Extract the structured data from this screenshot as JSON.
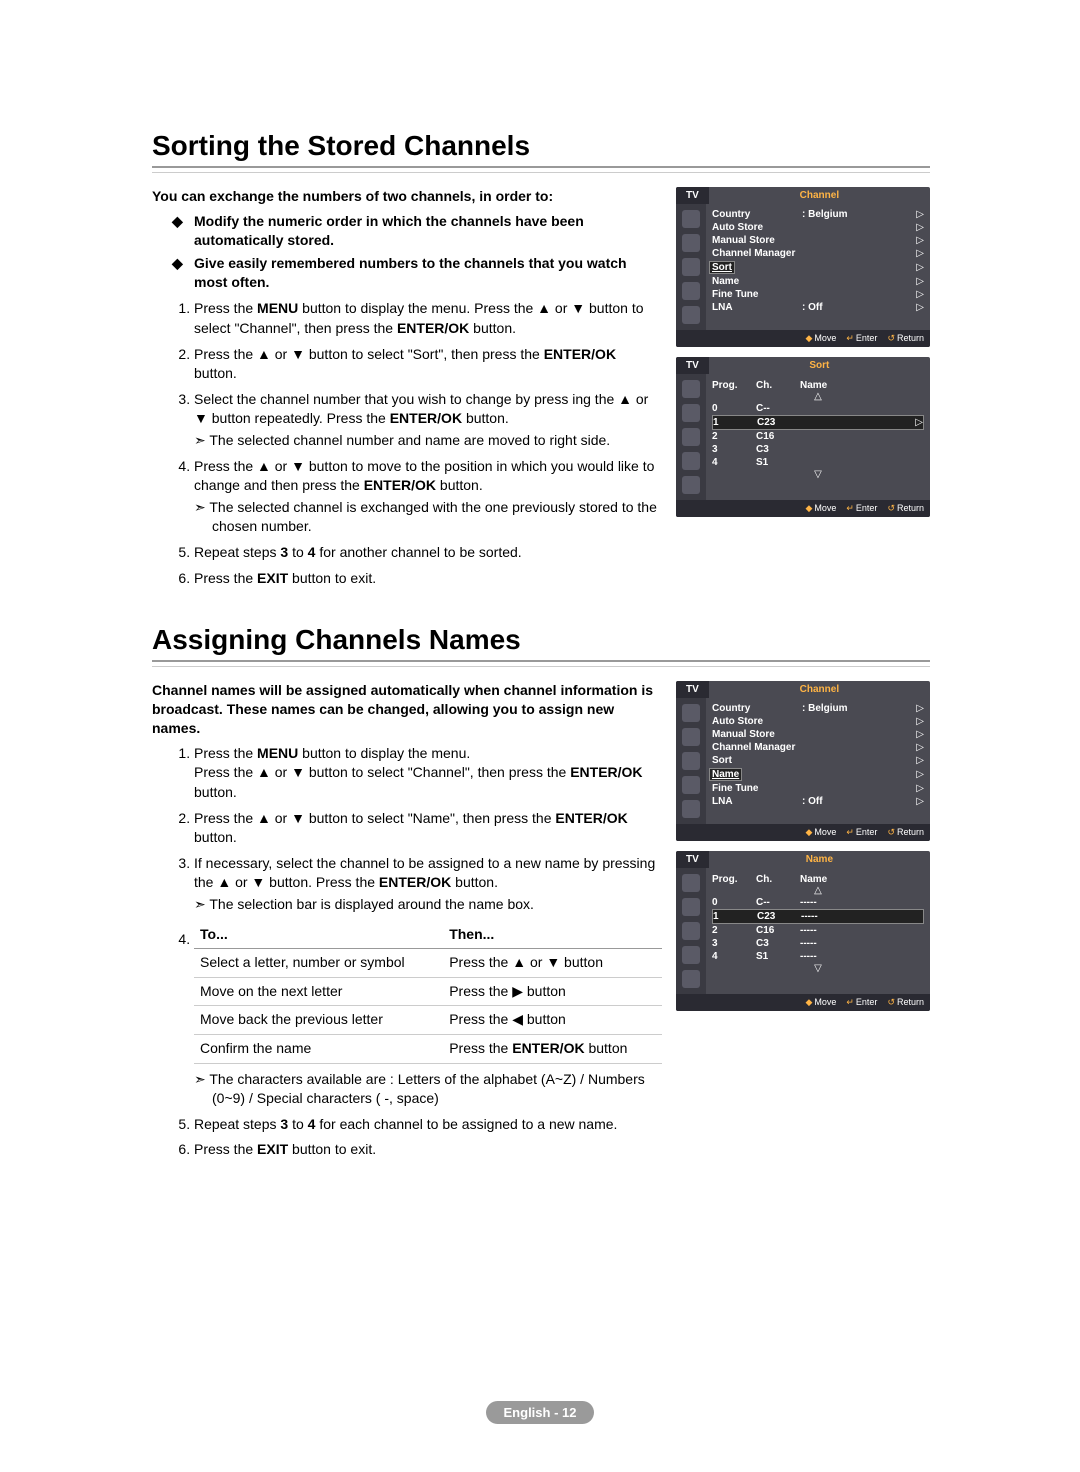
{
  "s1": {
    "heading": "Sorting the Stored Channels",
    "intro": "You can exchange the numbers of two channels, in order to:",
    "bul": [
      "Modify the numeric order in which the channels have been automatically stored.",
      "Give easily remembered numbers to the channels that you watch most often."
    ],
    "steps": [
      {
        "pre": "Press the ",
        "b1": "MENU",
        "mid": " button to display the menu.  Press the ▲ or ▼ button to select \"Channel\", then press the ",
        "b2": "ENTER/OK",
        "post": " button."
      },
      {
        "pre": "Press the ▲ or ▼ button to select \"Sort\", then press the ",
        "b1": "ENTER/OK",
        "post": " button."
      },
      {
        "pre": "Select the channel number that you wish to change by press ing the ▲ or ▼ button repeatedly. Press the ",
        "b1": "ENTER/OK",
        "post": " button.",
        "sub": "The selected channel number and name are moved to right side."
      },
      {
        "pre": "Press the ▲ or ▼ button to move to the position in which you would like to change and then press the  ",
        "b1": "ENTER/OK",
        "post": " button.",
        "sub": "The selected channel is exchanged with the one previously stored to the chosen number."
      },
      {
        "pre": "Repeat steps ",
        "b1": "3",
        "mid": " to ",
        "b2": "4",
        "post": " for another channel to be sorted."
      },
      {
        "pre": "Press the ",
        "b1": "EXIT",
        "post": " button to exit."
      }
    ]
  },
  "s2": {
    "heading": "Assigning Channels Names",
    "intro": "Channel names will be assigned automatically when channel information is broadcast. These names can be changed, allowing you to assign new names.",
    "steps": [
      {
        "pre": "Press the ",
        "b1": "MENU",
        "mid": " button to display the menu.\nPress the ▲ or ▼ button to select \"Channel\", then press the ",
        "b2": "ENTER/OK",
        "post": " button."
      },
      {
        "pre": "Press the ▲ or ▼ button to select \"Name\", then press the ",
        "b1": "ENTER/OK",
        "post": " button."
      },
      {
        "pre": "If necessary, select the channel to be assigned to a new name by pressing the ▲ or ▼ button. Press the ",
        "b1": "ENTER/OK",
        "post": " button.",
        "sub": "The selection bar is displayed around the name box."
      }
    ],
    "table": {
      "h1": "To...",
      "h2": "Then...",
      "rows": [
        [
          "Select a letter, number or symbol",
          "Press the ▲ or ▼ button"
        ],
        [
          "Move on the next letter",
          "Press the ▶ button"
        ],
        [
          "Move back the previous letter",
          "Press the ◀ button"
        ],
        [
          "Confirm the name",
          "Press the ENTER/OK button"
        ]
      ]
    },
    "after_table_sub": "The characters available are : Letters of the alphabet (A~Z) / Numbers (0~9) / Special characters ( -, space)",
    "step5": {
      "pre": "Repeat steps ",
      "b1": "3",
      "mid": " to ",
      "b2": "4",
      "post": " for each channel to be assigned to a new name."
    },
    "step6": {
      "pre": "Press the ",
      "b1": "EXIT",
      "post": " button to exit."
    }
  },
  "osd": {
    "tv": "TV",
    "channel_title": "Channel",
    "menu": [
      {
        "lbl": "Country",
        "val": ": Belgium",
        "arr": "▷"
      },
      {
        "lbl": "Auto Store",
        "val": "",
        "arr": "▷"
      },
      {
        "lbl": "Manual Store",
        "val": "",
        "arr": "▷"
      },
      {
        "lbl": "Channel Manager",
        "val": "",
        "arr": "▷"
      },
      {
        "lbl": "Sort",
        "val": "",
        "arr": "▷"
      },
      {
        "lbl": "Name",
        "val": "",
        "arr": "▷"
      },
      {
        "lbl": "Fine Tune",
        "val": "",
        "arr": "▷"
      },
      {
        "lbl": "LNA",
        "val": ": Off",
        "arr": "▷"
      }
    ],
    "foot": {
      "move": "Move",
      "enter": "Enter",
      "ret": "Return"
    },
    "sort": {
      "title": "Sort",
      "hdr": [
        "Prog.",
        "Ch.",
        "Name"
      ],
      "rows": [
        [
          "0",
          "C--",
          ""
        ],
        [
          "1",
          "C23",
          ""
        ],
        [
          "2",
          "C16",
          ""
        ],
        [
          "3",
          "C3",
          ""
        ],
        [
          "4",
          "S1",
          ""
        ]
      ]
    },
    "name": {
      "title": "Name",
      "hdr": [
        "Prog.",
        "Ch.",
        "Name"
      ],
      "rows": [
        [
          "0",
          "C--",
          "-----"
        ],
        [
          "1",
          "C23",
          "-----"
        ],
        [
          "2",
          "C16",
          "-----"
        ],
        [
          "3",
          "C3",
          "-----"
        ],
        [
          "4",
          "S1",
          "-----"
        ]
      ]
    }
  },
  "footer": "English - 12"
}
